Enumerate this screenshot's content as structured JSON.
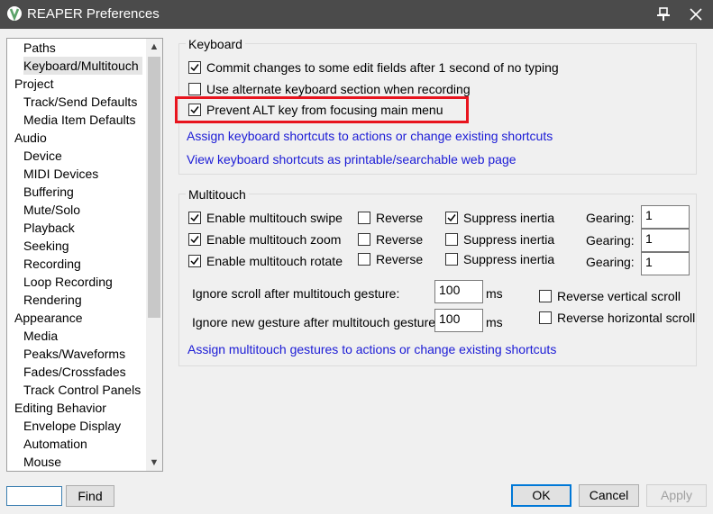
{
  "window": {
    "title": "REAPER Preferences",
    "pin_icon": "pin-icon",
    "close_icon": "close-icon"
  },
  "tree": {
    "items": [
      {
        "label": "Paths",
        "level": 1
      },
      {
        "label": "Keyboard/Multitouch",
        "level": 1,
        "selected": true
      },
      {
        "label": "Project",
        "level": 0
      },
      {
        "label": "Track/Send Defaults",
        "level": 1
      },
      {
        "label": "Media Item Defaults",
        "level": 1
      },
      {
        "label": "Audio",
        "level": 0
      },
      {
        "label": "Device",
        "level": 1
      },
      {
        "label": "MIDI Devices",
        "level": 1
      },
      {
        "label": "Buffering",
        "level": 1
      },
      {
        "label": "Mute/Solo",
        "level": 1
      },
      {
        "label": "Playback",
        "level": 1
      },
      {
        "label": "Seeking",
        "level": 1
      },
      {
        "label": "Recording",
        "level": 1
      },
      {
        "label": "Loop Recording",
        "level": 1
      },
      {
        "label": "Rendering",
        "level": 1
      },
      {
        "label": "Appearance",
        "level": 0
      },
      {
        "label": "Media",
        "level": 1
      },
      {
        "label": "Peaks/Waveforms",
        "level": 1
      },
      {
        "label": "Fades/Crossfades",
        "level": 1
      },
      {
        "label": "Track Control Panels",
        "level": 1
      },
      {
        "label": "Editing Behavior",
        "level": 0
      },
      {
        "label": "Envelope Display",
        "level": 1
      },
      {
        "label": "Automation",
        "level": 1
      },
      {
        "label": "Mouse",
        "level": 1
      }
    ]
  },
  "find": {
    "value": "",
    "button_label": "Find"
  },
  "keyboard": {
    "group_title": "Keyboard",
    "commit_changes": {
      "label": "Commit changes to some edit fields after 1 second of no typing",
      "checked": true
    },
    "alternate_section": {
      "label": "Use alternate keyboard section when recording",
      "checked": false
    },
    "prevent_alt": {
      "label": "Prevent ALT key from focusing main menu",
      "checked": true
    },
    "link_assign": "Assign keyboard shortcuts to actions or change existing shortcuts",
    "link_view": "View keyboard shortcuts as printable/searchable web page"
  },
  "multitouch": {
    "group_title": "Multitouch",
    "rows": [
      {
        "enable_label": "Enable multitouch swipe",
        "enable_checked": true,
        "reverse_label": "Reverse",
        "reverse_checked": false,
        "suppress_label": "Suppress inertia",
        "suppress_checked": true,
        "gearing_label": "Gearing:",
        "gearing_value": "1"
      },
      {
        "enable_label": "Enable multitouch zoom",
        "enable_checked": true,
        "reverse_label": "Reverse",
        "reverse_checked": false,
        "suppress_label": "Suppress inertia",
        "suppress_checked": false,
        "gearing_label": "Gearing:",
        "gearing_value": "1"
      },
      {
        "enable_label": "Enable multitouch rotate",
        "enable_checked": true,
        "reverse_label": "Reverse",
        "reverse_checked": false,
        "suppress_label": "Suppress inertia",
        "suppress_checked": false,
        "gearing_label": "Gearing:",
        "gearing_value": "1"
      }
    ],
    "ignore_scroll": {
      "label": "Ignore scroll after multitouch gesture:",
      "value": "100",
      "unit": "ms"
    },
    "ignore_new": {
      "label": "Ignore new gesture after multitouch gesture:",
      "value": "100",
      "unit": "ms"
    },
    "reverse_vertical": {
      "label": "Reverse vertical scroll",
      "checked": false
    },
    "reverse_horizontal": {
      "label": "Reverse horizontal scroll",
      "checked": false
    },
    "link_assign": "Assign multitouch gestures to actions or change existing shortcuts"
  },
  "buttons": {
    "ok": "OK",
    "cancel": "Cancel",
    "apply": "Apply"
  },
  "colors": {
    "link": "#1b1bd6",
    "highlight": "#e8141e",
    "titlebar": "#4b4b4b",
    "default_button_border": "#0078d7"
  }
}
